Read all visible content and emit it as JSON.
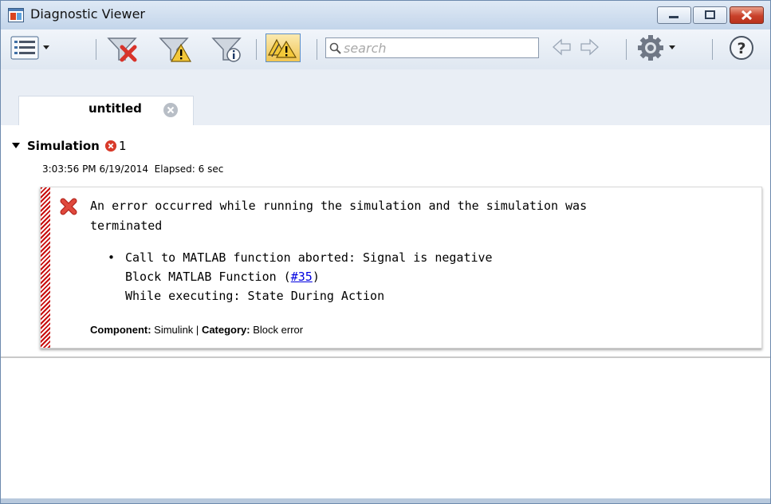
{
  "window": {
    "title": "Diagnostic Viewer"
  },
  "toolbar": {
    "search_placeholder": "search",
    "buttons": [
      "view-options",
      "filter-errors",
      "filter-warnings",
      "filter-info",
      "toggle-warnings",
      "navigate-previous",
      "navigate-next",
      "settings",
      "help"
    ]
  },
  "tabs": [
    {
      "label": "untitled",
      "active": true
    }
  ],
  "report": {
    "section_title": "Simulation",
    "error_count": "1",
    "timestamp": "3:03:56 PM 6/19/2014",
    "elapsed": "Elapsed: 6 sec",
    "message": {
      "line1": "An error occurred while running the simulation and the simulation was",
      "line2": "terminated",
      "bullet": "•",
      "detail1": "Call to MATLAB function aborted: Signal is negative",
      "detail2_prefix": "Block MATLAB Function (",
      "detail2_link": "#35",
      "detail2_suffix": ")",
      "detail3": "While executing: State During Action",
      "component_label": "Component:",
      "component_value": "Simulink",
      "separator": "|",
      "category_label": "Category:",
      "category_value": "Block error"
    }
  },
  "colors": {
    "error": "#d83a2a",
    "link": "#0000e0",
    "stripe": "#c80d0d",
    "selected_toggle": "#f2c13a"
  }
}
